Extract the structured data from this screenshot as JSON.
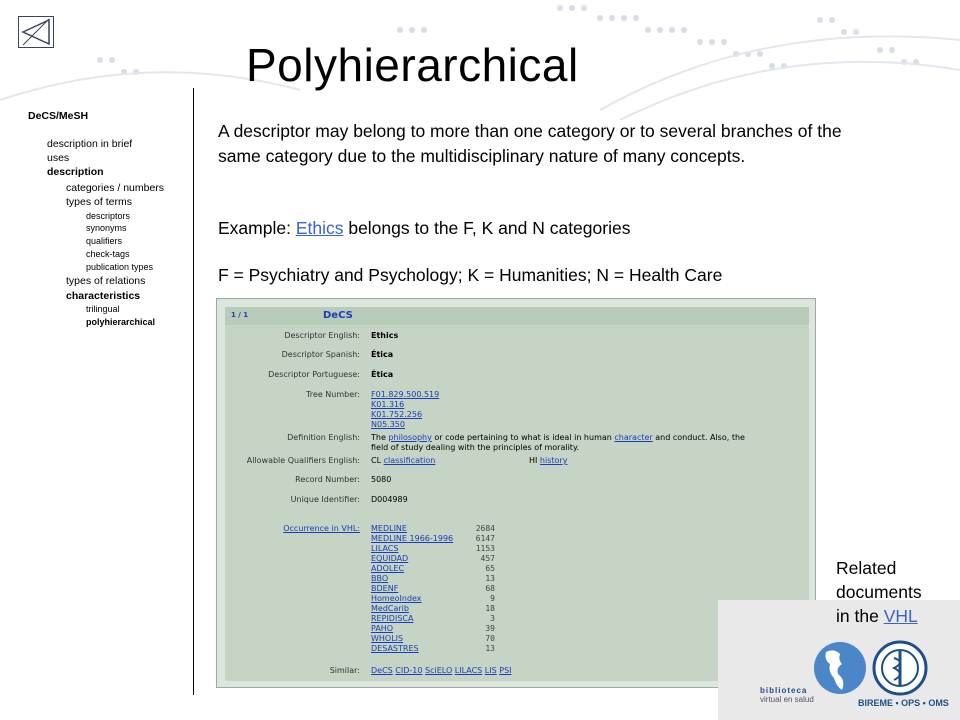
{
  "title": "Polyhierarchical",
  "sidebar": {
    "heading": "DeCS/MeSH",
    "items": [
      {
        "label": "description in brief"
      },
      {
        "label": "uses"
      },
      {
        "label": "description"
      },
      {
        "label": "categories / numbers"
      },
      {
        "label": "types of terms"
      },
      {
        "label": "descriptors"
      },
      {
        "label": "synonyms"
      },
      {
        "label": "qualifiers"
      },
      {
        "label": "check-tags"
      },
      {
        "label": "publication types"
      },
      {
        "label": "types of relations"
      },
      {
        "label": "characteristics"
      },
      {
        "label": "trilingual"
      },
      {
        "label": "polyhierarchical"
      }
    ]
  },
  "body": {
    "para1": "A descriptor may belong to more than one category or to several branches of the same category due to the multidisciplinary nature of many concepts.",
    "example_prefix": "Example: ",
    "example_link": "Ethics",
    "example_suffix": " belongs to the F, K and N categories",
    "categories_line": "F = Psychiatry and Psychology; K = Humanities; N = Health Care"
  },
  "decs_record": {
    "page": "1 / 1",
    "brand": "DeCS",
    "labels": {
      "english": "Descriptor English:",
      "spanish": "Descriptor Spanish:",
      "portuguese": "Descriptor Portuguese:",
      "tree": "Tree Number:",
      "definition": "Definition English:",
      "qualifiers": "Allowable Qualifiers English:",
      "record": "Record Number:",
      "unique": "Unique Identifier:",
      "occurrence": "Occurrence in VHL:",
      "similar": "Similar:"
    },
    "english": "Ethics",
    "spanish": "Ética",
    "portuguese": "Ética",
    "tree_numbers": [
      "F01.829.500.519",
      "K01.316",
      "K01.752.256",
      "N05.350"
    ],
    "definition": {
      "t1": "The ",
      "l1": "philosophy",
      "t2": " or code pertaining to what is ideal in human ",
      "l2": "character",
      "t3": " and conduct. Also, the",
      "line2": "field of study dealing with the principles of morality."
    },
    "qualifiers": {
      "cl": "CL",
      "cl_link": "classification",
      "hi": "HI",
      "hi_link": "history"
    },
    "record_number": "5080",
    "unique_id": "D004989",
    "occurrences": [
      {
        "name": "MEDLINE",
        "count": "2684"
      },
      {
        "name": "MEDLINE 1966-1996",
        "count": "6147"
      },
      {
        "name": "LILACS",
        "count": "1153"
      },
      {
        "name": "EQUIDAD",
        "count": "457"
      },
      {
        "name": "ADOLEC",
        "count": "65"
      },
      {
        "name": "BBO",
        "count": "13"
      },
      {
        "name": "BDENF",
        "count": "68"
      },
      {
        "name": "HomeoIndex",
        "count": "9"
      },
      {
        "name": "MedCarib",
        "count": "18"
      },
      {
        "name": "REPIDISCA",
        "count": "3"
      },
      {
        "name": "PAHO",
        "count": "39"
      },
      {
        "name": "WHOLIS",
        "count": "70"
      },
      {
        "name": "DESASTRES",
        "count": "13"
      }
    ],
    "similar": [
      "DeCS",
      "CID-10",
      "SciELO",
      "LILACS",
      "LIS",
      "PSI"
    ]
  },
  "related": {
    "line1": "Related",
    "line2": "documents",
    "line3_prefix": "in the ",
    "link": "VHL"
  },
  "logos": {
    "lib1": "biblioteca",
    "lib2": "virtual en salud",
    "bireme": "BIREME • OPS • OMS"
  },
  "colors": {
    "link": "#3b64c8",
    "panel_bg": "#c5d4c5",
    "header_bg": "#b9ccb9"
  },
  "icons": {
    "back": "back-arrow-icon",
    "americas": "americas-globe-icon",
    "who": "who-emblem-icon"
  }
}
